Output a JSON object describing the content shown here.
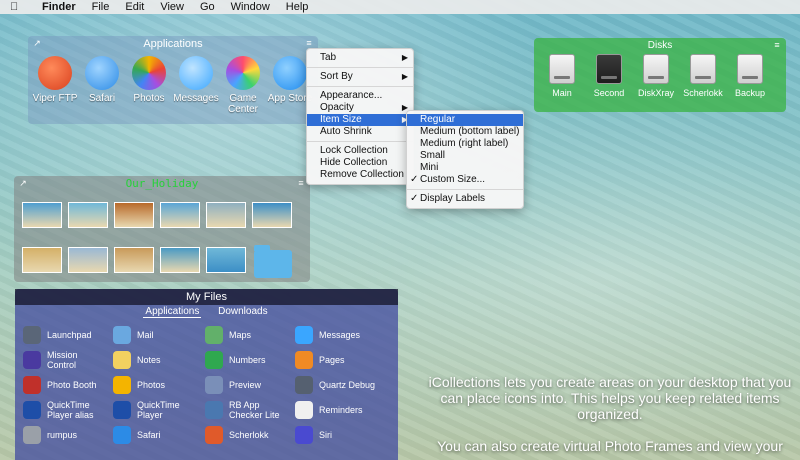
{
  "menubar": {
    "app": "Finder",
    "items": [
      "File",
      "Edit",
      "View",
      "Go",
      "Window",
      "Help"
    ]
  },
  "applications": {
    "title": "Applications",
    "items": [
      {
        "label": "Viper FTP",
        "icon": "viper-ftp-icon",
        "color": "#d9401e"
      },
      {
        "label": "Safari",
        "icon": "safari-icon",
        "color": "#2c8be6"
      },
      {
        "label": "Photos",
        "icon": "photos-icon",
        "color": "#f4b400"
      },
      {
        "label": "Messages",
        "icon": "messages-icon",
        "color": "#3aa6ff"
      },
      {
        "label": "Game Center",
        "icon": "game-center-icon",
        "color": "#a64ee0"
      },
      {
        "label": "App Store",
        "icon": "app-store-icon",
        "color": "#1f8cf0"
      }
    ]
  },
  "disks": {
    "title": "Disks",
    "items": [
      "Main",
      "Second",
      "DiskXray",
      "Scherlokk",
      "Backup"
    ]
  },
  "holiday": {
    "title": "Our_Holiday",
    "photos": [
      "#4f9fd0",
      "#6fb8d8",
      "#b86a2a",
      "#5aa6d6",
      "#8fb0c0",
      "#3d8fc6",
      "#d4b068",
      "#9ab8d4",
      "#c89a5a",
      "#4a9ac4"
    ]
  },
  "myfiles": {
    "title": "My Files",
    "tabs": [
      "Applications",
      "Downloads"
    ],
    "items": [
      {
        "label": "Launchpad",
        "color": "#5a6678"
      },
      {
        "label": "Mail",
        "color": "#6aa8e0"
      },
      {
        "label": "Maps",
        "color": "#62b06a"
      },
      {
        "label": "Messages",
        "color": "#3aa6ff"
      },
      {
        "label": "Mission Control",
        "color": "#4a3aa0"
      },
      {
        "label": "Notes",
        "color": "#f2d160"
      },
      {
        "label": "Numbers",
        "color": "#2fa84f"
      },
      {
        "label": "Pages",
        "color": "#f08a24"
      },
      {
        "label": "Photo Booth",
        "color": "#c0302a"
      },
      {
        "label": "Photos",
        "color": "#f4b400"
      },
      {
        "label": "Preview",
        "color": "#7a8fb8"
      },
      {
        "label": "Quartz Debug",
        "color": "#556070"
      },
      {
        "label": "QuickTime Player alias",
        "color": "#1e4ea8"
      },
      {
        "label": "QuickTime Player",
        "color": "#1e4ea8"
      },
      {
        "label": "RB App Checker Lite",
        "color": "#4a78b0"
      },
      {
        "label": "Reminders",
        "color": "#f0f0f0"
      },
      {
        "label": "rumpus",
        "color": "#9aa0a8"
      },
      {
        "label": "Safari",
        "color": "#2c8be6"
      },
      {
        "label": "Scherlokk",
        "color": "#e05a2a"
      },
      {
        "label": "Siri",
        "color": "#4a4ad0"
      }
    ]
  },
  "context_menu": {
    "items": [
      {
        "label": "Tab",
        "submenu": true
      },
      {
        "sep": true
      },
      {
        "label": "Sort By",
        "submenu": true
      },
      {
        "sep": true
      },
      {
        "label": "Appearance...",
        "submenu": false
      },
      {
        "label": "Opacity",
        "submenu": true
      },
      {
        "label": "Item Size",
        "submenu": true,
        "selected": true
      },
      {
        "label": "Auto Shrink",
        "submenu": false
      },
      {
        "sep": true
      },
      {
        "label": "Lock Collection",
        "submenu": false
      },
      {
        "label": "Hide Collection",
        "submenu": false
      },
      {
        "label": "Remove Collection",
        "submenu": false
      }
    ]
  },
  "submenu": {
    "items": [
      {
        "label": "Regular",
        "selected": true,
        "checked": false
      },
      {
        "label": "Medium (bottom label)",
        "checked": false
      },
      {
        "label": "Medium (right label)",
        "checked": false
      },
      {
        "label": "Small",
        "checked": false
      },
      {
        "label": "Mini",
        "checked": false
      },
      {
        "label": "Custom Size...",
        "checked": true
      },
      {
        "sep": true
      },
      {
        "label": "Display Labels",
        "checked": true
      }
    ]
  },
  "promo": {
    "line1": "iCollections lets you create areas on your desktop that you can place icons into. This helps you keep related items organized.",
    "line2": "You can also create virtual Photo Frames and view your"
  }
}
